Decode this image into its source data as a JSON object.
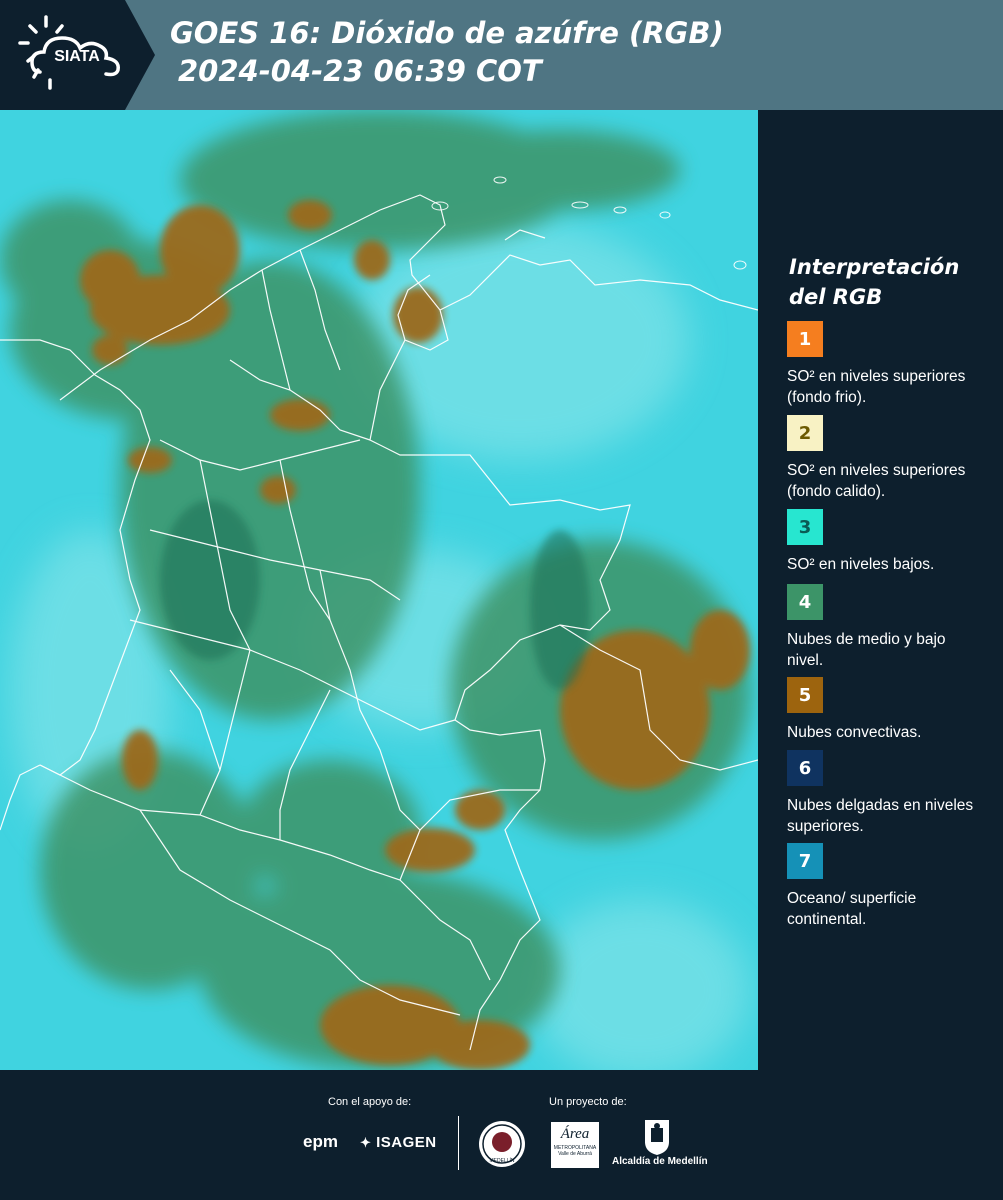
{
  "header": {
    "logo_text": "SIATA",
    "title": "GOES 16: Dióxido de azúfre (RGB)",
    "timestamp": "2024-04-23 06:39 COT"
  },
  "legend": {
    "title_line1": "Interpretación",
    "title_line2": "del RGB",
    "items": [
      {
        "number": "1",
        "color": "#f57e1f",
        "text": "SO² en niveles superiores (fondo frio)."
      },
      {
        "number": "2",
        "color": "#f8f2c4",
        "text": "SO² en niveles superiores (fondo calido)."
      },
      {
        "number": "3",
        "color": "#27e6d0",
        "text": "SO² en niveles bajos."
      },
      {
        "number": "4",
        "color": "#3c9468",
        "text": "Nubes de medio y bajo nivel."
      },
      {
        "number": "5",
        "color": "#9d640e",
        "text": "Nubes convectivas."
      },
      {
        "number": "6",
        "color": "#0f3360",
        "text": "Nubes delgadas en niveles superiores."
      },
      {
        "number": "7",
        "color": "#1591b7",
        "text": "Oceano/ superficie continental."
      }
    ]
  },
  "footer": {
    "support_label": "Con el apoyo de:",
    "project_label": "Un proyecto de:",
    "sponsors": [
      "epm",
      "ISAGEN"
    ],
    "partners": [
      "Medellín",
      "Área Metropolitana Valle de Aburrá",
      "Alcaldía de Medellín"
    ],
    "epm_text": "epm",
    "isagen_text": "ISAGEN",
    "seal_text": "MEDELLÍN",
    "area_text": "Área",
    "area_sub1": "METROPOLITANA",
    "area_sub2": "Valle de Aburrá",
    "alcaldia_text": "Alcaldía de Medellín"
  },
  "map": {
    "colors": {
      "ocean": "#3ed3de",
      "low_cloud": "#3c9468",
      "convective": "#9d640e",
      "borders": "#ffffff"
    }
  }
}
